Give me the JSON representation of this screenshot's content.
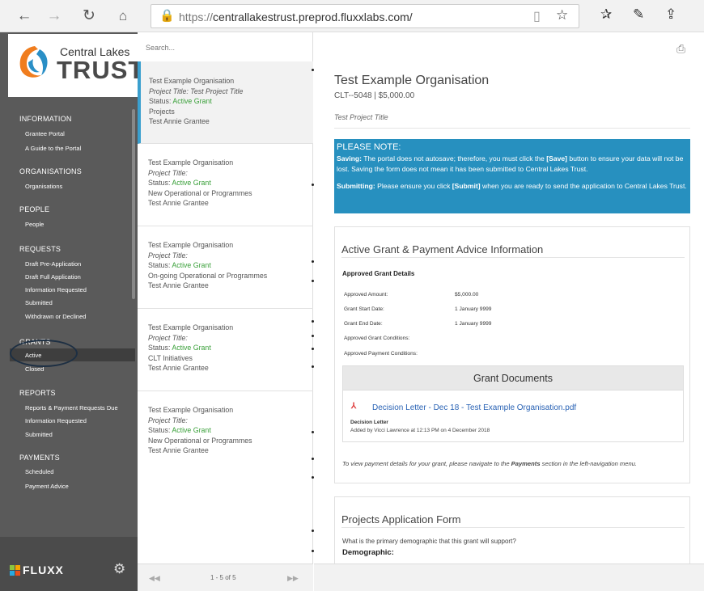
{
  "browser": {
    "url_prefix": "https://",
    "url_host": "centrallakestrust.preprod.fluxxlabs.com/",
    "icons": [
      "back-arrow-icon",
      "forward-arrow-icon",
      "refresh-icon",
      "home-icon",
      "lock-icon",
      "reading-view-icon",
      "favorite-star-icon",
      "favorites-list-icon",
      "pen-icon",
      "share-icon"
    ]
  },
  "logo": {
    "line1": "Central Lakes",
    "line2": "TRUST"
  },
  "sidebar": {
    "sections": [
      {
        "title": "INFORMATION",
        "items": [
          "Grantee Portal",
          "A Guide to the Portal"
        ]
      },
      {
        "title": "ORGANISATIONS",
        "items": [
          "Organisations"
        ]
      },
      {
        "title": "PEOPLE",
        "items": [
          "People"
        ]
      },
      {
        "title": "REQUESTS",
        "items": [
          "Draft Pre-Application",
          "Draft Full Application",
          "Information Requested",
          "Submitted",
          "Withdrawn or Declined"
        ]
      },
      {
        "title": "GRANTS",
        "items": [
          "Active",
          "Closed"
        ]
      },
      {
        "title": "REPORTS",
        "items": [
          "Reports & Payment Requests Due",
          "Information Requested",
          "Submitted"
        ]
      },
      {
        "title": "PAYMENTS",
        "items": [
          "Scheduled",
          "Payment Advice"
        ]
      }
    ],
    "brand": "FLUXX"
  },
  "list": {
    "search_placeholder": "Search...",
    "cards": [
      {
        "org": "Test Example Organisation",
        "project": "Project Title: Test Project Title",
        "status_label": "Status:",
        "status": "Active Grant",
        "program": "Projects",
        "grantee": "Test Annie Grantee"
      },
      {
        "org": "Test Example Organisation",
        "project": "Project Title:",
        "status_label": "Status:",
        "status": "Active Grant",
        "program": "New Operational or Programmes",
        "grantee": "Test Annie Grantee"
      },
      {
        "org": "Test Example Organisation",
        "project": "Project Title:",
        "status_label": "Status:",
        "status": "Active Grant",
        "program": "On-going Operational or Programmes",
        "grantee": "Test Annie Grantee"
      },
      {
        "org": "Test Example Organisation",
        "project": "Project Title:",
        "status_label": "Status:",
        "status": "Active Grant",
        "program": "CLT Initiatives",
        "grantee": "Test Annie Grantee"
      },
      {
        "org": "Test Example Organisation",
        "project": "Project Title:",
        "status_label": "Status:",
        "status": "Active Grant",
        "program": "New Operational or Programmes",
        "grantee": "Test Annie Grantee"
      }
    ],
    "pagination": {
      "prev": "◀◀",
      "label": "1 - 5 of 5",
      "next": "▶▶"
    }
  },
  "detail": {
    "title": "Test Example Organisation",
    "subtitle": "CLT--5048 | $5,000.00",
    "project_title": "Test Project Title",
    "notice": {
      "heading": "PLEASE NOTE:",
      "saving_label": "Saving:",
      "saving_text_1": " The portal does not autosave; therefore, you must click the ",
      "save_word": "[Save]",
      "saving_text_2": " button to ensure your data will not be lost. Saving the form does not mean it has been submitted to Central Lakes Trust.",
      "submitting_label": "Submitting:",
      "submitting_text_1": " Please ensure you click ",
      "submit_word": "[Submit]",
      "submitting_text_2": " when you are ready to send the application to Central Lakes Trust."
    },
    "advice": {
      "title": "Active Grant & Payment Advice Information",
      "approved_heading": "Approved Grant Details",
      "fields": [
        {
          "label": "Approved Amount:",
          "value": "$5,000.00"
        },
        {
          "label": "Grant Start Date:",
          "value": "1 January 9999"
        },
        {
          "label": "Grant End Date:",
          "value": "1 January 9999"
        },
        {
          "label": "Approved Grant Conditions:",
          "value": ""
        },
        {
          "label": "Approved Payment Conditions:",
          "value": ""
        }
      ],
      "documents": {
        "heading": "Grant Documents",
        "file_name": "Decision Letter - Dec 18 - Test Example Organisation.pdf",
        "file_type": "Decision Letter",
        "added_by": "Added by Vicci Lawrence at 12:13 PM on 4 December 2018"
      },
      "payment_note_1": "To view payment details for your grant, please navigate to the ",
      "payment_note_bold": "Payments",
      "payment_note_2": " section in the left-navigation menu."
    },
    "projects_form": {
      "title": "Projects Application Form",
      "question": "What is the primary demographic that this grant will support?",
      "field_label": "Demographic:"
    }
  }
}
